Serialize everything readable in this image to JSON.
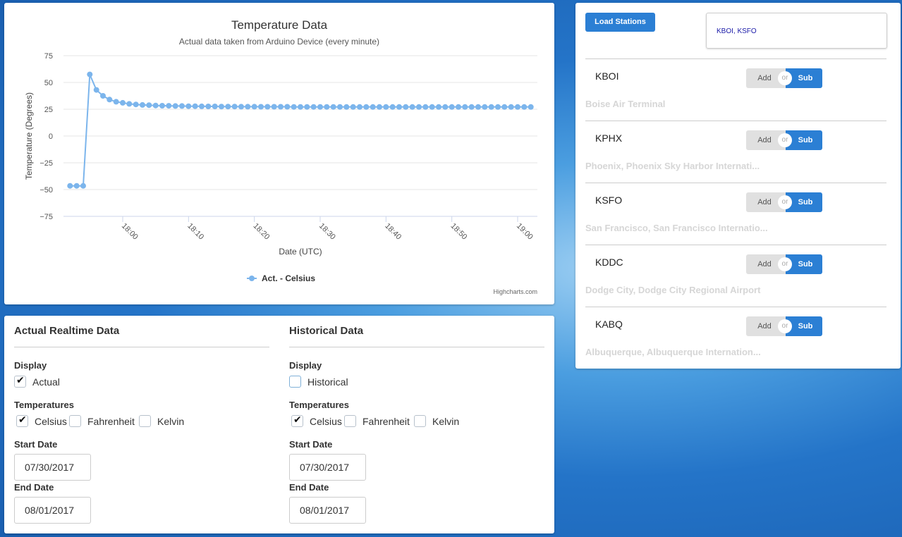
{
  "chart_data": {
    "type": "line",
    "title": "Temperature Data",
    "subtitle": "Actual data taken from Arduino Device (every minute)",
    "xlabel": "Date (UTC)",
    "ylabel": "Temperature (Degrees)",
    "ylim": [
      -75,
      75
    ],
    "yticks": [
      "75",
      "50",
      "25",
      "0",
      "−25",
      "−50",
      "−75"
    ],
    "xticks": [
      "18:00",
      "18:10",
      "18:20",
      "18:30",
      "18:40",
      "18:50",
      "19:00"
    ],
    "grid": "horizontal",
    "legend": "bottom-center",
    "credits": "Highcharts.com",
    "series": [
      {
        "name": "Act. - Celsius",
        "color": "#7cb5ec",
        "x": [
          "17:52",
          "17:53",
          "17:54",
          "17:55",
          "17:56",
          "17:57",
          "17:58",
          "17:59",
          "18:00",
          "18:01",
          "18:02",
          "18:03",
          "18:04",
          "18:05",
          "18:06",
          "18:07",
          "18:08",
          "18:09",
          "18:10",
          "18:11",
          "18:12",
          "18:13",
          "18:14",
          "18:15",
          "18:16",
          "18:17",
          "18:18",
          "18:19",
          "18:20",
          "18:21",
          "18:22",
          "18:23",
          "18:24",
          "18:25",
          "18:26",
          "18:27",
          "18:28",
          "18:29",
          "18:30",
          "18:31",
          "18:32",
          "18:33",
          "18:34",
          "18:35",
          "18:36",
          "18:37",
          "18:38",
          "18:39",
          "18:40",
          "18:41",
          "18:42",
          "18:43",
          "18:44",
          "18:45",
          "18:46",
          "18:47",
          "18:48",
          "18:49",
          "18:50",
          "18:51",
          "18:52",
          "18:53",
          "18:54",
          "18:55",
          "18:56",
          "18:57",
          "18:58",
          "18:59",
          "19:00",
          "19:01",
          "19:02"
        ],
        "values": [
          -46.5,
          -46.5,
          -46.5,
          57.5,
          43,
          37.5,
          34,
          32,
          31,
          30,
          29.5,
          29,
          28.8,
          28.5,
          28.3,
          28.2,
          28,
          28,
          27.8,
          27.8,
          27.7,
          27.6,
          27.6,
          27.5,
          27.5,
          27.5,
          27.4,
          27.4,
          27.4,
          27.3,
          27.3,
          27.3,
          27.3,
          27.3,
          27.2,
          27.2,
          27.2,
          27.2,
          27.2,
          27.2,
          27.2,
          27.2,
          27.1,
          27.1,
          27.1,
          27.1,
          27.1,
          27.1,
          27.1,
          27.1,
          27.1,
          27.1,
          27.1,
          27.1,
          27.1,
          27.1,
          27.1,
          27.1,
          27.1,
          27.1,
          27.1,
          27.1,
          27.1,
          27.1,
          27.1,
          27.1,
          27.1,
          27.1,
          27.1,
          27.1,
          27.1
        ]
      }
    ]
  },
  "controls": {
    "realtime": {
      "heading": "Actual Realtime Data",
      "display_label": "Display",
      "display_option": "Actual",
      "display_checked": true,
      "temps_label": "Temperatures",
      "celsius": "Celsius",
      "fahrenheit": "Fahrenheit",
      "kelvin": "Kelvin",
      "celsius_checked": true,
      "fahrenheit_checked": false,
      "kelvin_checked": false,
      "start_label": "Start Date",
      "start_value": "07/30/2017",
      "end_label": "End Date",
      "end_value": "08/01/2017"
    },
    "historical": {
      "heading": "Historical Data",
      "display_label": "Display",
      "display_option": "Historical",
      "display_checked": false,
      "temps_label": "Temperatures",
      "celsius": "Celsius",
      "fahrenheit": "Fahrenheit",
      "kelvin": "Kelvin",
      "celsius_checked": true,
      "fahrenheit_checked": false,
      "kelvin_checked": false,
      "start_label": "Start Date",
      "start_value": "07/30/2017",
      "end_label": "End Date",
      "end_value": "08/01/2017"
    }
  },
  "stations": {
    "load_button": "Load Stations",
    "selected": "KBOI, KSFO",
    "add_label": "Add",
    "or_label": "or",
    "sub_label": "Sub",
    "list": [
      {
        "code": "KBOI",
        "name": "Boise Air Terminal"
      },
      {
        "code": "KPHX",
        "name": "Phoenix, Phoenix Sky Harbor Internati..."
      },
      {
        "code": "KSFO",
        "name": "San Francisco, San Francisco Internatio..."
      },
      {
        "code": "KDDC",
        "name": "Dodge City, Dodge City Regional Airport"
      },
      {
        "code": "KABQ",
        "name": "Albuquerque, Albuquerque Internation..."
      }
    ]
  }
}
